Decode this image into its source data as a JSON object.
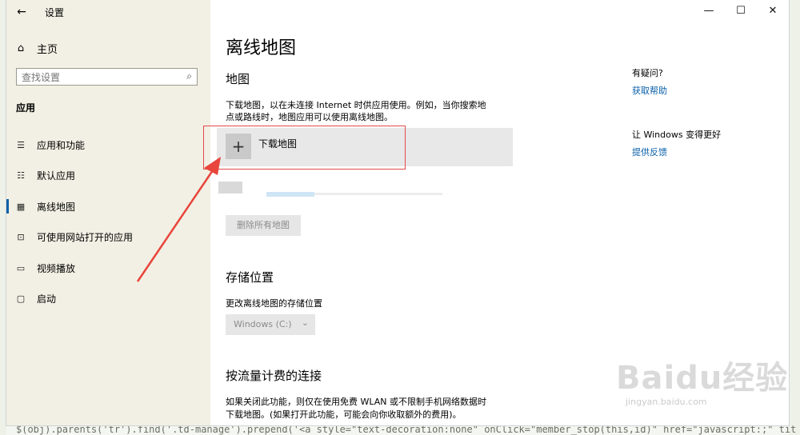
{
  "titlebar": {
    "back_icon": "←",
    "title": "设置",
    "minimize": "—",
    "maximize": "☐",
    "close": "✕"
  },
  "nav": {
    "home": {
      "icon": "⌂",
      "label": "主页"
    },
    "search": {
      "placeholder": "查找设置",
      "icon": "⌕"
    },
    "section": "应用",
    "items": [
      {
        "icon": "☰",
        "label": "应用和功能"
      },
      {
        "icon": "☷",
        "label": "默认应用"
      },
      {
        "icon": "▦",
        "label": "离线地图"
      },
      {
        "icon": "⊡",
        "label": "可使用网站打开的应用"
      },
      {
        "icon": "▭",
        "label": "视频播放"
      },
      {
        "icon": "▢",
        "label": "启动"
      }
    ]
  },
  "main": {
    "title": "离线地图",
    "maps_heading": "地图",
    "maps_desc_line1": "下载地图，以在未连接 Internet 时供应用使用。例如，当你搜索地",
    "maps_desc_line2": "点或路线时，地图应用可以使用离线地图。",
    "download_icon": "+",
    "download_label": "下载地图",
    "delete_all": "删除所有地图",
    "storage_heading": "存储位置",
    "storage_desc": "更改离线地图的存储位置",
    "storage_value": "Windows (C:)",
    "storage_chevron": "⌄",
    "metered_heading": "按流量计费的连接",
    "metered_line1": "如果关闭此功能，则仅在使用免费 WLAN 或不限制手机网络数据时",
    "metered_line2": "下载地图。(如果打开此功能，可能会向你收取额外的费用)。"
  },
  "side": {
    "question": "有疑问?",
    "get_help": "获取帮助",
    "improve": "让 Windows 变得更好",
    "feedback": "提供反馈"
  },
  "watermark": {
    "brand": "Baidu经验",
    "url": "jingyan.baidu.com"
  },
  "background_code": "$(obj).parents('tr').find('.td-manage').prepend('<a style=\"text-decoration:none\" onClick=\"member_stop(this,id)\" href=\"javascript:;\" tit",
  "colors": {
    "accent": "#0a5fa8",
    "highlight": "#e24a4a"
  }
}
